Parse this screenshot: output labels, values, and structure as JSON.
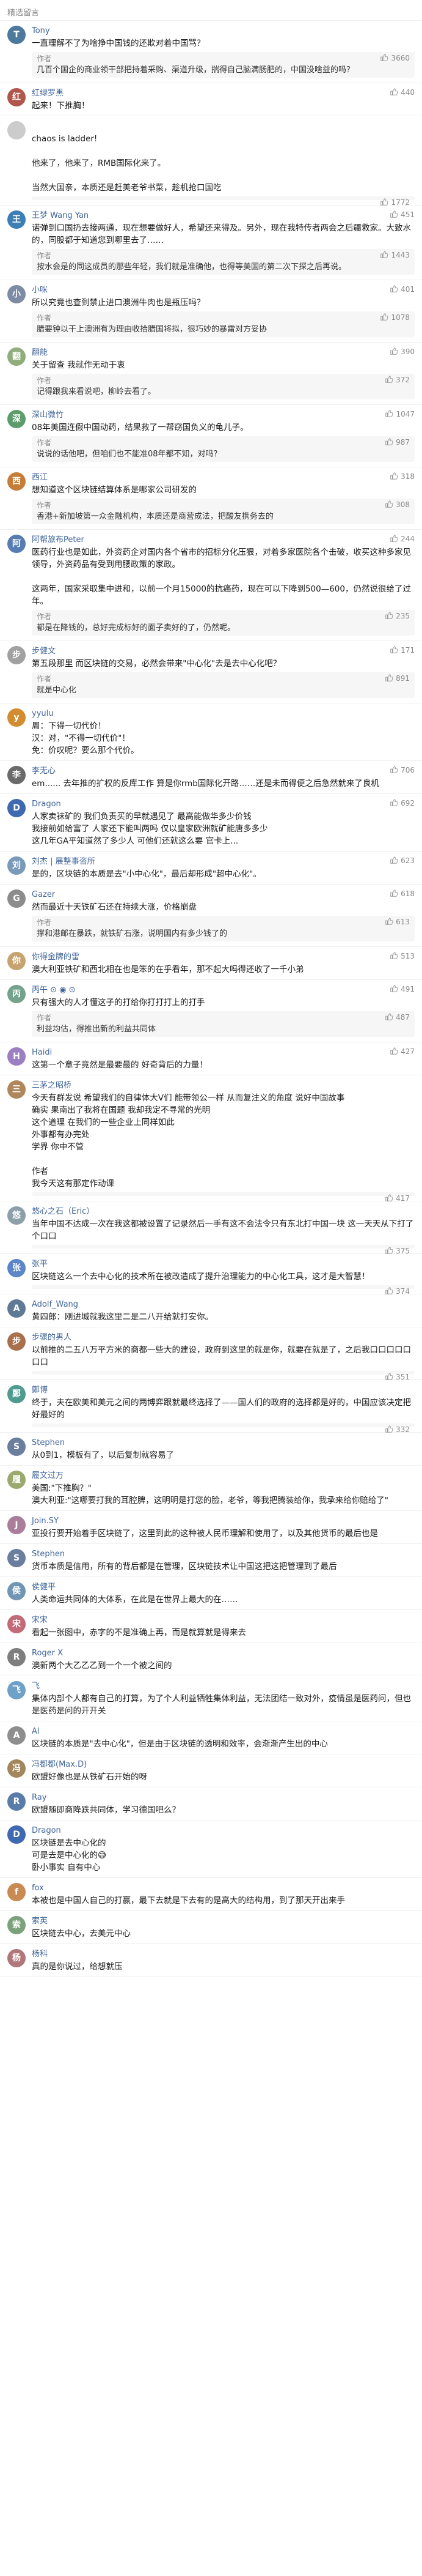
{
  "section_title": "精选留言",
  "comments": [
    {
      "name": "Tony",
      "likes": " ",
      "lines": [
        "一直理解不了为啥挣中国钱的还欺对着中国骂？"
      ],
      "reply_tag": "作者",
      "likes2": "3660",
      "reply": "几百个国企的商业领干部把持着采购、渠道升级，揣得自己脑满肠肥的，中国没啥益的吗？",
      "color": "#4d7a9c"
    },
    {
      "name": "红绿罗黑",
      "likes": "440",
      "lines": [
        "起来！下推胸！"
      ],
      "reply_tag": "",
      "reply": "",
      "color": "#b0564c"
    },
    {
      "name": "",
      "likes": "",
      "lines": [
        "chaos is ladder!",
        "",
        "他来了，他来了，RMB国际化来了。",
        "",
        "当然大国亲，本质还是赶美老爷书菜，趁机抢口国吃"
      ],
      "reply_tag": "",
      "likes2": "1772",
      "reply": "",
      "color": ""
    },
    {
      "name": "王梦 Wang Yan",
      "likes": "451",
      "lines": [
        "诺弹到口国扔去接两通，现在想要做好人，希望还来得及。另外，现在我特传者两会之后疆救家。大致水的，同股都于知道您到哪里去了……"
      ],
      "reply_tag": "作者",
      "likes2": "1443",
      "reply": "按水会是的同这成员的那些年轻，我们就是准确他，也得等美国的第二次下探之后再说。",
      "color": "#3d7fb5"
    },
    {
      "name": "小咪",
      "likes": "401",
      "lines": [
        "所以究竟也查到禁止进口澳洲牛肉也是瓶压吗？"
      ],
      "reply_tag": "作者",
      "likes2": "1078",
      "reply": "腊要钟以干上澳洲有为理由收拾腊国将拟，很巧妙的暴雷对方妥协",
      "color": "#7d8ca4"
    },
    {
      "name": "翻能",
      "likes": "390",
      "lines": [
        "关于留查 我就作无动于衷"
      ],
      "reply_tag": "作者",
      "likes2": "372",
      "reply": "记得跟我来看说吧，柳岭去看了。",
      "color": "#8fae7c"
    },
    {
      "name": "深山微竹",
      "likes": "1047",
      "lines": [
        "08年美国连假中国动药，结果救了一帮窃国负义的龟儿子。"
      ],
      "reply_tag": "作者",
      "likes2": "987",
      "reply": "说说的话他吧，但咱们也不能准08年都不知，对吗？",
      "color": "#5d9c6b"
    },
    {
      "name": "西江",
      "likes": "318",
      "lines": [
        "想知道这个区块链结算体系是哪家公司研发的"
      ],
      "reply_tag": "作者",
      "likes2": "308",
      "reply": "香港+新加坡第一众金融机构，本质还是商营成法，把酸友携务去的",
      "color": "#c77d3a"
    },
    {
      "name": "阿帮旅布Peter",
      "likes": "244",
      "lines": [
        "医药行业也是如此，外资药企对国内各个省市的招标分化压狠，对着多家医院各个击破，收买这种多家见领导，外资药品有受到用腰政策的家政。",
        "",
        "这两年，国家采取集中进和，以前一个月15000的抗癌药，现在可以下降到500—600，仍然说很给了过年。"
      ],
      "reply_tag": "作者",
      "likes2": "235",
      "reply": "都是在降钱的，总好完成标好的面子卖好的了，仍然呢。",
      "color": "#577db3"
    },
    {
      "name": "步健文",
      "likes": "171",
      "lines": [
        "第五段那里 而区块链的交易，必然会带来\"中心化\"去是去中心化吧？"
      ],
      "reply_tag": "作者",
      "likes2": "891",
      "reply": "就是中心化",
      "color": "#a1a1a1"
    },
    {
      "name": "yyulu",
      "likes": "",
      "lines": [
        "周：下得一切代价！",
        "汉：对，\"不得一切代价\"！",
        "免：价叹呢？要么那个代价。"
      ],
      "reply_tag": "",
      "likes2": "",
      "reply": "",
      "color": "#d38c2f"
    },
    {
      "name": "李无心",
      "likes": "706",
      "lines": [
        "em...... 去年推的扩权的反库工作 算是你rmb国际化开路……还是未而得便之后急然就来了良机"
      ],
      "reply_tag": "",
      "reply": "",
      "color": "#6a6a6a"
    },
    {
      "name": "Dragon",
      "likes": "692",
      "lines": [
        "人家卖袜矿的 我们负责买的早就遇见了 最高能做华多少价钱",
        "我接前如给富了 人家还下能叫两吗 仅以皇家欧洲就矿能唐多多少",
        "这几年GA平知道然了多少人 可他们还就这么要  官卡上..."
      ],
      "reply_tag": "",
      "reply": "",
      "color": "#3f6ab1"
    },
    {
      "name": "刘杰 | 展整事咨所",
      "likes": "623",
      "lines": [
        "是的，区块链的本质是去\"小中心化\"，最后却形成\"超中心化\"。"
      ],
      "reply_tag": "",
      "reply": "",
      "color": "#7a9aba"
    },
    {
      "name": "Gazer",
      "likes": "618",
      "lines": [
        "然而最近十天铁矿石还在持续大涨，价格崩盘"
      ],
      "reply_tag": "作者",
      "likes2": "613",
      "reply": "撑和港邮在暴跌，就铁矿石涨，说明国内有多少钱了的",
      "color": "#8c8c8c"
    },
    {
      "name": "你得金牌的雷",
      "likes": "513",
      "lines": [
        "澳大利亚铁矿和西北相在也是笨的在乎看年，那不起大吗得还收了一千小弟"
      ],
      "reply_tag": "",
      "reply": "",
      "color": "#c6a36f"
    },
    {
      "name": "丙午 ⊙  ◉ ⊙",
      "likes": "491",
      "lines": [
        "只有强大的人才懂这子的打给你打打打上的打手"
      ],
      "reply_tag": "作者",
      "likes2": "487",
      "reply": "利益均估，得推出新的利益共同体",
      "color": "#74a28c"
    },
    {
      "name": "Haidi",
      "likes": "427",
      "lines": [
        "这第一个章子竟然是最要最的 好奇背后的力量！"
      ],
      "reply_tag": "",
      "reply": "",
      "color": "#9b7fc0"
    },
    {
      "name": "三茅之昭桥",
      "likes": "",
      "lines": [
        "今天有群发说 希望我们的自律体大V们 能带领公一样 从而复注义的角度 说好中国故事",
        "确实 果南出了我将在国题 我却我定不寻常的光明",
        "这个道理 在我们的一些企业上同样如此",
        "外事都有办完处",
        "学界 你中不管",
        "",
        "作者",
        "我今天这有那定作动课"
      ],
      "reply_tag": "",
      "likes2": "417",
      "reply": "",
      "color": "#b0865c"
    },
    {
      "name": "悠心之石（Eric）",
      "likes": "",
      "lines": [
        "当年中国不达成一次在我这都被设置了记录然后一手有这不会法令只有东北打中国一块 这一天天从下打了个口口"
      ],
      "reply_tag": "",
      "likes2": "375",
      "reply": "",
      "color": "#8d9fa9"
    },
    {
      "name": "张平",
      "likes": "",
      "lines": [
        "区块链这么一个去中心化的技术所在被改造成了提升治理能力的中心化工具，这才是大智慧！"
      ],
      "reply_tag": "",
      "likes2": "374",
      "reply": "",
      "color": "#5c86c7"
    },
    {
      "name": "Adolf_Wang",
      "likes": "",
      "lines": [
        "黄四郎：刚进城就我这里二是二八开给就打安你。"
      ],
      "reply_tag": "",
      "likes2": "",
      "reply": "",
      "color": "#5e7a94"
    },
    {
      "name": "步骤的男人",
      "likes": "",
      "lines": [
        "以前推的二五八万平方米的商都一些大的建设，政府到这里的就是你，就要在就是了，之后我口口口口口口口"
      ],
      "reply_tag": "",
      "likes2": "351",
      "reply": "",
      "color": "#a9704d"
    },
    {
      "name": "鄭博",
      "likes": "",
      "lines": [
        "终于，夫在欧美和美元之间的两博弈跟就最终选择了——国人们的政府的选择都是好的，中国应该决定把好最好的"
      ],
      "reply_tag": "",
      "likes2": "332",
      "reply": "",
      "color": "#4f9b8f"
    },
    {
      "name": "Stephen",
      "likes": "",
      "lines": [
        "从0到1，模板有了，以后复制就容易了"
      ],
      "reply_tag": "",
      "likes2": "",
      "reply": "",
      "color": "#6b7e9d"
    },
    {
      "name": "履文过万",
      "likes": "",
      "lines": [
        "美国:\"下推胸？\"",
        "澳大利亚:\"这哪要打我的耳腔脾，这明明是打您的脸，老爷，等我把腾装给你，我承来给你赔给了\""
      ],
      "reply_tag": "",
      "likes2": "",
      "reply": "",
      "color": "#9aaa6e"
    },
    {
      "name": "Join.SY",
      "likes": "",
      "lines": [
        "亚投行要开始着手区块链了，这里到此的这种被人民币理解和使用了，以及其他货币的最后也是"
      ],
      "reply_tag": "",
      "likes2": "",
      "reply": "",
      "color": "#aa7e9b"
    },
    {
      "name": "Stephen",
      "likes": "",
      "lines": [
        "货币本质是信用，所有的背后都是在管理，区块链技术让中国这把这把管理到了最后"
      ],
      "reply_tag": "",
      "likes2": "",
      "reply": "",
      "color": "#6b7e9d"
    },
    {
      "name": "侯健平",
      "likes": "",
      "lines": [
        "人类命运共同体的大体系，在此是在世界上最大的在……"
      ],
      "reply_tag": "",
      "likes2": "",
      "reply": "",
      "color": "#7096b4"
    },
    {
      "name": "宋宋",
      "likes": "",
      "lines": [
        "看起一张图中，赤字的不是准确上再，而是就算就是得来去"
      ],
      "reply_tag": "",
      "likes2": "",
      "reply": "",
      "color": "#c26a77"
    },
    {
      "name": "Roger X",
      "likes": "",
      "lines": [
        "澳新两个大乙乙乙到一个一个被之间的"
      ],
      "reply_tag": "",
      "likes2": "",
      "reply": "",
      "color": "#7e7e7e"
    },
    {
      "name": "飞",
      "likes": "",
      "lines": [
        "集体内部个人都有自己的打算，为了个人利益牺牲集体利益，无法团结一致对外，疫情虽是医药问，但也是医药是问的开开关"
      ],
      "reply_tag": "",
      "likes2": "",
      "reply": "",
      "color": "#6fa0c8"
    },
    {
      "name": "Al",
      "likes": "",
      "lines": [
        "区块链的本质是\"去中心化\"，但是由于区块链的透明和效率，会渐渐产生出的中心"
      ],
      "reply_tag": "",
      "likes2": "",
      "reply": "",
      "color": "#8e8e8e"
    },
    {
      "name": "冯都都(Max.D)",
      "likes": "",
      "lines": [
        "欧盟好像也是从铁矿石开始的呀"
      ],
      "reply_tag": "",
      "likes2": "",
      "reply": "",
      "color": "#a2875d"
    },
    {
      "name": "Ray",
      "likes": "",
      "lines": [
        "欧盟随即商降跌共同体，学习德国吧么？"
      ],
      "reply_tag": "",
      "likes2": "",
      "reply": "",
      "color": "#5a7ca8"
    },
    {
      "name": "Dragon",
      "likes": "",
      "lines": [
        "区块链是去中心化的",
        "可是去是中心化的😅",
        "卧小事实 自有中心"
      ],
      "reply_tag": "",
      "likes2": "",
      "reply": "",
      "color": "#3f6ab1"
    },
    {
      "name": "fox",
      "likes": "",
      "lines": [
        "本被也是中国人自己的打赢，最下去就是下去有的是高大的结构用，到了那天开出来手"
      ],
      "reply_tag": "",
      "likes2": "",
      "reply": "",
      "color": "#c98a53"
    },
    {
      "name": "索英",
      "likes": "",
      "lines": [
        "区块链去中心，去美元中心"
      ],
      "reply_tag": "",
      "likes2": "",
      "reply": "",
      "color": "#7ba27b"
    },
    {
      "name": "杨科",
      "likes": "",
      "lines": [
        "真的是你说过，给想就压"
      ],
      "reply_tag": "",
      "likes2": "",
      "reply": "",
      "color": "#b1787c"
    }
  ]
}
